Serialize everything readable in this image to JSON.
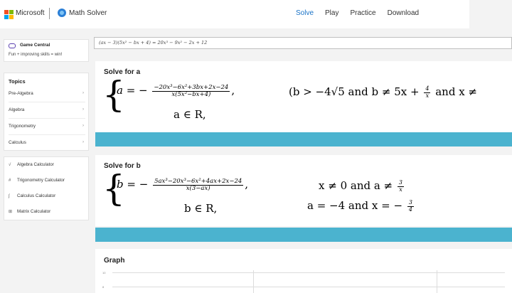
{
  "header": {
    "brand": "Microsoft",
    "app_name": "Math Solver",
    "nav": [
      "Solve",
      "Play",
      "Practice",
      "Download"
    ],
    "active_nav": "Solve"
  },
  "colors": {
    "accent": "#1a73c7",
    "bar": "#4bb3cf",
    "ms_red": "#f25022",
    "ms_green": "#7fba00",
    "ms_blue": "#00a4ef",
    "ms_yellow": "#ffb900"
  },
  "sidebar": {
    "game_central": {
      "title": "Game Central",
      "subtitle": "Fun + improving skills = win!",
      "icon": "gamepad-icon"
    },
    "topics": {
      "title": "Topics",
      "items": [
        {
          "label": "Pre-Algebra"
        },
        {
          "label": "Algebra"
        },
        {
          "label": "Trigonometry"
        },
        {
          "label": "Calculus"
        }
      ]
    },
    "calculators": [
      {
        "label": "Algebra Calculator",
        "icon": "square-root-icon",
        "glyph": "√"
      },
      {
        "label": "Trigonometry Calculator",
        "icon": "hash-icon",
        "glyph": "#"
      },
      {
        "label": "Calculus Calculator",
        "icon": "calculus-icon",
        "glyph": "∫"
      },
      {
        "label": "Matrix Calculator",
        "icon": "matrix-icon",
        "glyph": "⊞"
      }
    ]
  },
  "input": {
    "expression": "(ax − 3)(5x² − bx + 4) = 20x³ − 9x² − 2x + 12"
  },
  "solve_a": {
    "title": "Solve for a",
    "lhs": "a = −",
    "num": "−20x³−6x²+3bx+2x−24",
    "den": "x(5x²−bx+4)",
    "condition_start": "(b > −4√5 and b ≠ 5x +",
    "cond_frac_num": "4",
    "cond_frac_den": "x",
    "condition_end": "and x ≠",
    "domain": "a ∈ R,"
  },
  "solve_b": {
    "title": "Solve for b",
    "lhs": "b = −",
    "num": "5ax³−20x³−6x²+4ax+2x−24",
    "den": "x(3−ax)",
    "cond1_start": "x ≠ 0 and a ≠",
    "cond1_frac_num": "3",
    "cond1_frac_den": "x",
    "domain": "b ∈ R,",
    "cond2_start": "a = −4 and x = −",
    "cond2_frac_num": "3",
    "cond2_frac_den": "4"
  },
  "graph": {
    "title": "Graph",
    "tick_labels": [
      "10",
      "8"
    ]
  }
}
